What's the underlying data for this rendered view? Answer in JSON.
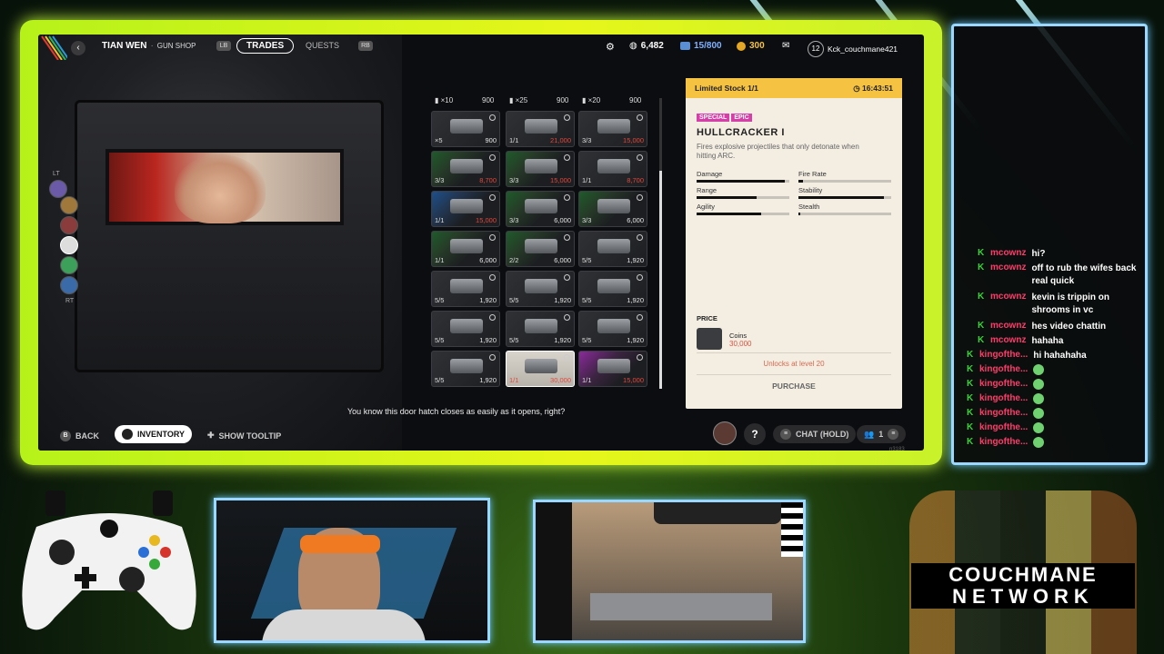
{
  "topbar": {
    "trader_name": "TIAN WEN",
    "trader_role": "GUN SHOP",
    "lb": "LB",
    "rb": "RB",
    "tabs": [
      "TRADES",
      "QUESTS"
    ],
    "raider_tokens": "6,482",
    "capacity": "15/800",
    "coins": "300",
    "level": "12",
    "username": "Kck_couchmane421"
  },
  "side": {
    "lt": "LT",
    "rt": "RT"
  },
  "grid": {
    "headers": [
      {
        "qty": "×10",
        "price": "900"
      },
      {
        "qty": "×25",
        "price": "900"
      },
      {
        "qty": "×20",
        "price": "900"
      }
    ],
    "cells": [
      {
        "qty": "×5",
        "price": "900",
        "rarity": "none",
        "red": false
      },
      {
        "qty": "1/1",
        "price": "21,000",
        "rarity": "none",
        "red": true
      },
      {
        "qty": "3/3",
        "price": "15,000",
        "rarity": "none",
        "red": true
      },
      {
        "qty": "3/3",
        "price": "8,700",
        "rarity": "green",
        "red": true
      },
      {
        "qty": "3/3",
        "price": "15,000",
        "rarity": "green",
        "red": true
      },
      {
        "qty": "1/1",
        "price": "8,700",
        "rarity": "none",
        "red": true
      },
      {
        "qty": "1/1",
        "price": "15,000",
        "rarity": "blue",
        "red": true
      },
      {
        "qty": "3/3",
        "price": "6,000",
        "rarity": "green",
        "red": false
      },
      {
        "qty": "3/3",
        "price": "6,000",
        "rarity": "green",
        "red": false
      },
      {
        "qty": "1/1",
        "price": "6,000",
        "rarity": "green",
        "red": false
      },
      {
        "qty": "2/2",
        "price": "6,000",
        "rarity": "green",
        "red": false
      },
      {
        "qty": "5/5",
        "price": "1,920",
        "rarity": "none",
        "red": false
      },
      {
        "qty": "5/5",
        "price": "1,920",
        "rarity": "none",
        "red": false
      },
      {
        "qty": "5/5",
        "price": "1,920",
        "rarity": "none",
        "red": false
      },
      {
        "qty": "5/5",
        "price": "1,920",
        "rarity": "none",
        "red": false
      },
      {
        "qty": "5/5",
        "price": "1,920",
        "rarity": "none",
        "red": false
      },
      {
        "qty": "5/5",
        "price": "1,920",
        "rarity": "none",
        "red": false
      },
      {
        "qty": "5/5",
        "price": "1,920",
        "rarity": "none",
        "red": false
      },
      {
        "qty": "5/5",
        "price": "1,920",
        "rarity": "none",
        "red": false
      },
      {
        "qty": "1/1",
        "price": "30,000",
        "rarity": "selected",
        "red": true
      },
      {
        "qty": "1/1",
        "price": "15,000",
        "rarity": "purple",
        "red": true
      }
    ]
  },
  "detail": {
    "stock": "Limited Stock  1/1",
    "timer": "16:43:51",
    "badge_special": "SPECIAL",
    "badge_epic": "EPIC",
    "name": "HULLCRACKER I",
    "description": "Fires explosive projectiles that only detonate when hitting ARC.",
    "stats": [
      {
        "label": "Damage",
        "value": 0.95
      },
      {
        "label": "Fire Rate",
        "value": 0.05
      },
      {
        "label": "Range",
        "value": 0.65
      },
      {
        "label": "Stability",
        "value": 0.92
      },
      {
        "label": "Agility",
        "value": 0.7
      },
      {
        "label": "Stealth",
        "value": 0.02
      }
    ],
    "price_label": "PRICE",
    "price_currency": "Coins",
    "price_value": "30,000",
    "unlock": "Unlocks at level 20",
    "purchase": "PURCHASE"
  },
  "subtitle": "You know this door hatch closes as easily as it opens, right?",
  "hints": {
    "back_key": "B",
    "back": "BACK",
    "inventory": "INVENTORY",
    "tooltip": "SHOW TOOLTIP",
    "help": "?",
    "chat": "CHAT (HOLD)",
    "party": "1",
    "version": "n3183"
  },
  "chat": [
    {
      "user": "mcownz",
      "msg": "hi?"
    },
    {
      "user": "mcownz",
      "msg": "off to rub the wifes back real quick"
    },
    {
      "user": "mcownz",
      "msg": "kevin is trippin on shrooms in vc"
    },
    {
      "user": "mcownz",
      "msg": "hes video chattin"
    },
    {
      "user": "mcownz",
      "msg": "hahaha"
    },
    {
      "user": "kingofthe...",
      "msg": "hi hahahaha"
    },
    {
      "user": "kingofthe...",
      "msg": ""
    },
    {
      "user": "kingofthe...",
      "msg": ""
    },
    {
      "user": "kingofthe...",
      "msg": ""
    },
    {
      "user": "kingofthe...",
      "msg": ""
    },
    {
      "user": "kingofthe...",
      "msg": ""
    },
    {
      "user": "kingofthe...",
      "msg": ""
    }
  ],
  "brand": {
    "line1": "COUCHMANE",
    "line2": "NETWORK"
  },
  "colors": {
    "accent_yellow": "#f5c242",
    "frame_green": "#c8f21a",
    "chat_red": "#ff3b6b",
    "epic_pink": "#d63fa8"
  }
}
